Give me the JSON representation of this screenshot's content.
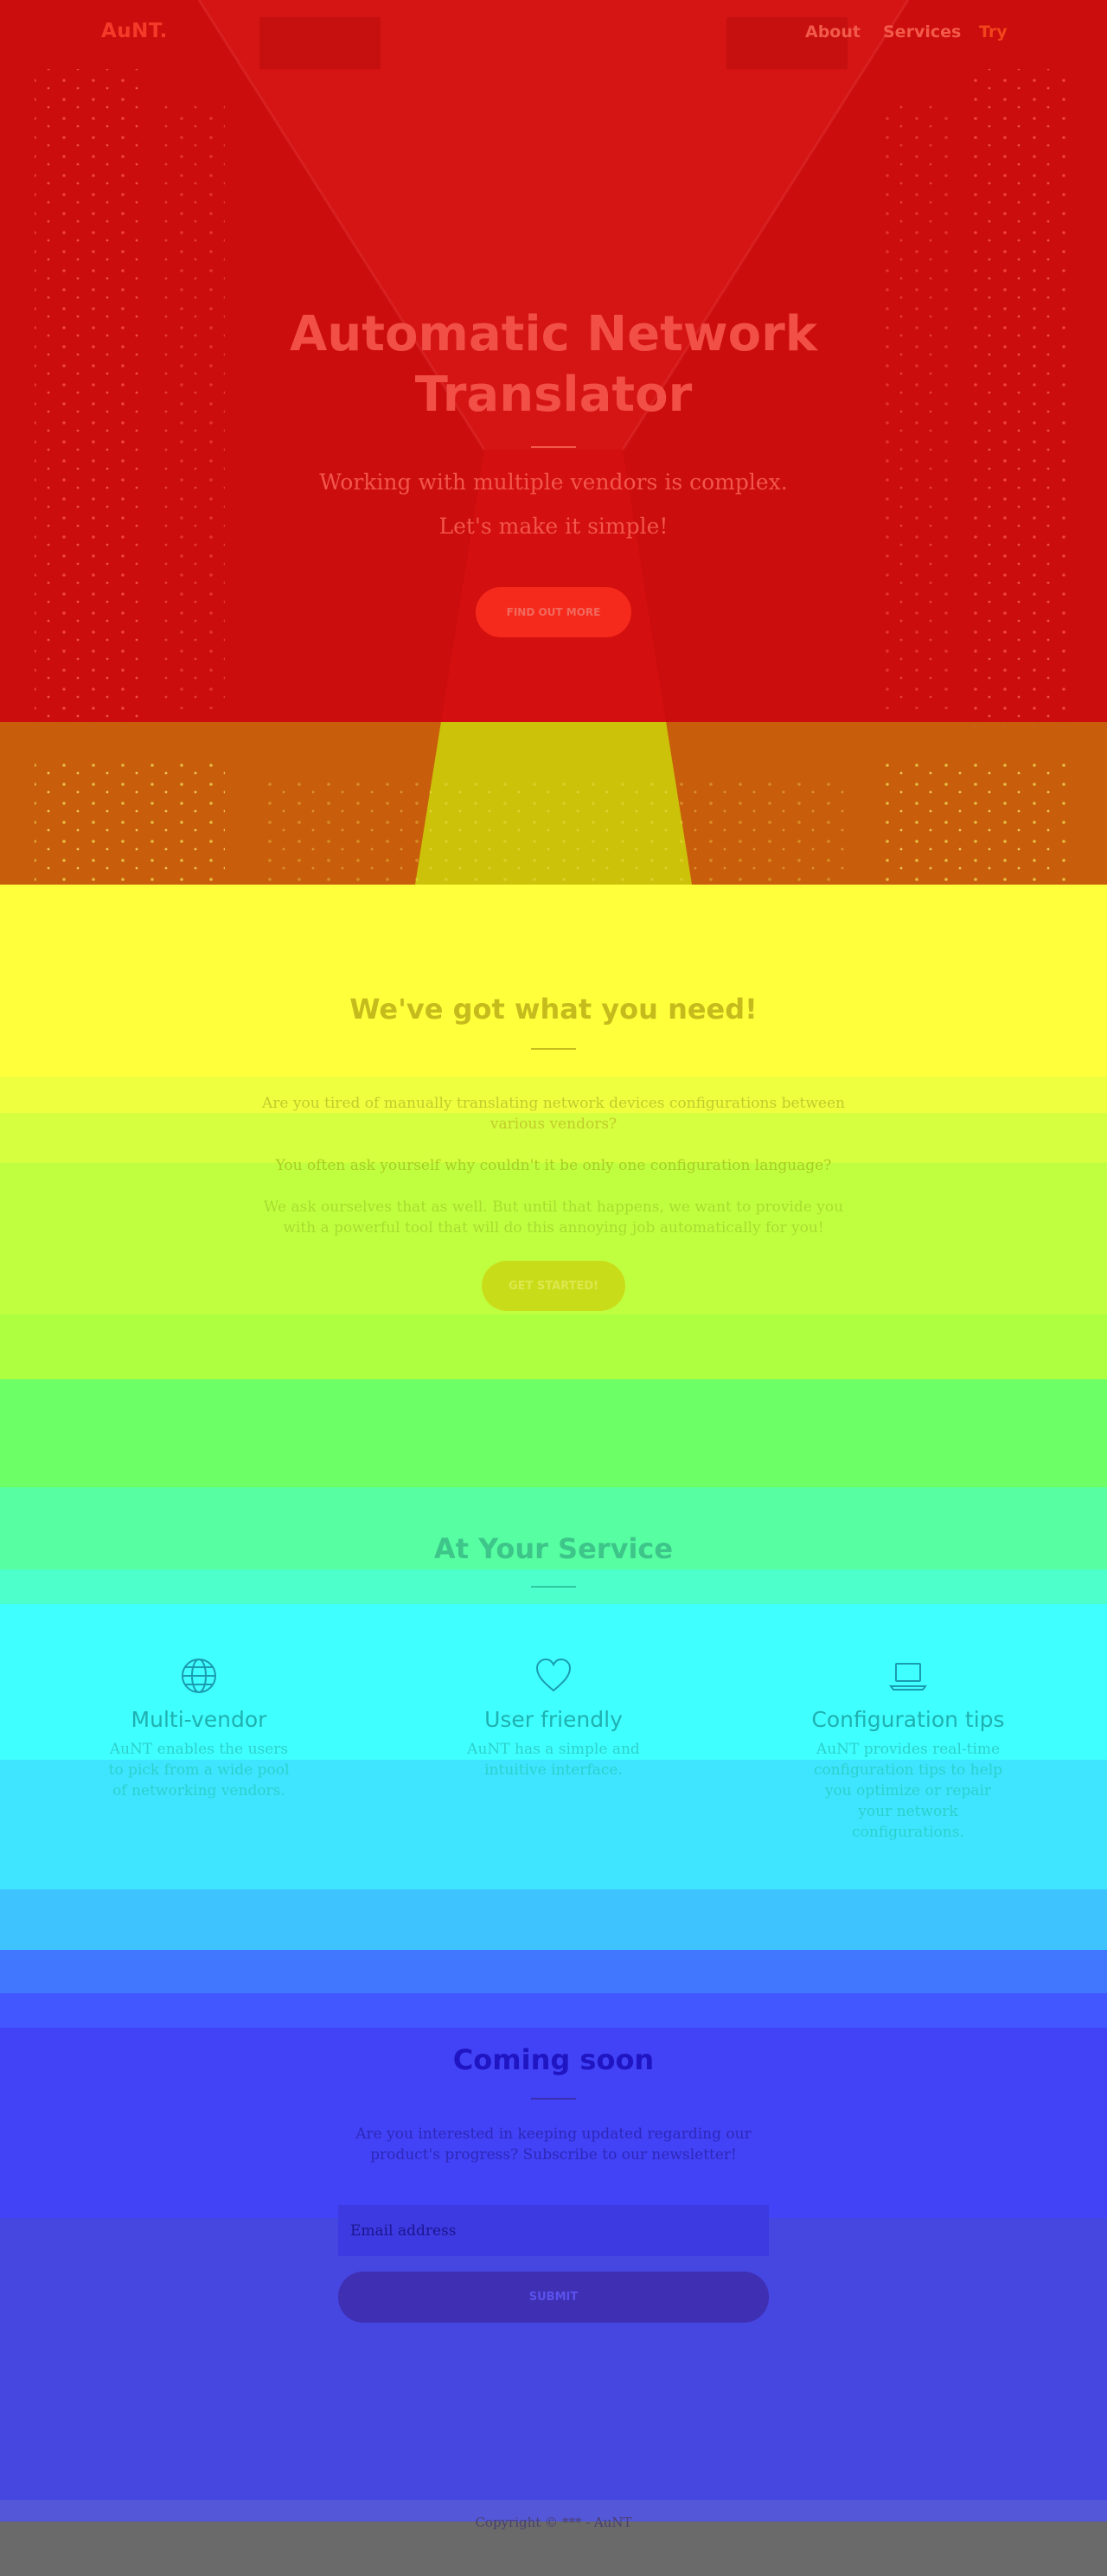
{
  "nav": {
    "brand": "AuNT.",
    "links": [
      "About",
      "Services",
      "Try"
    ]
  },
  "hero": {
    "title_line1": "Automatic Network",
    "title_line2": "Translator",
    "subtitle_line1": "Working with multiple vendors is complex.",
    "subtitle_line2": "Let's make it simple!",
    "button_label": "FIND OUT MORE"
  },
  "intro": {
    "title": "We've got what you need!",
    "para1": "Are you tired of manually translating network devices configurations between various vendors?",
    "para2": "You often ask yourself why couldn't it be only one configuration language?",
    "para3": "We ask ourselves that as well. But until that happens, we want to provide you with a powerful tool that will do this annoying job automatically for you!",
    "button_label": "GET STARTED!"
  },
  "services": {
    "title": "At Your Service",
    "items": [
      {
        "icon": "globe-icon",
        "title": "Multi-vendor",
        "desc": "AuNT enables the users to pick from a wide pool of networking vendors."
      },
      {
        "icon": "heart-icon",
        "title": "User friendly",
        "desc": "AuNT has a simple and intuitive interface."
      },
      {
        "icon": "laptop-icon",
        "title": "Configuration tips",
        "desc": "AuNT provides real-time configuration tips to help you optimize or repair your network configurations."
      }
    ]
  },
  "newsletter": {
    "title": "Coming soon",
    "text": "Are you interested in keeping updated regarding our product's progress? Subscribe to our newsletter!",
    "email_placeholder": "Email address",
    "submit_label": "SUBMIT"
  },
  "footer": {
    "copyright": "Copyright © *** - AuNT"
  },
  "colors": {
    "hero": "#d10e0e",
    "accent": "#f62a1c",
    "intro_button": "#c9dc1a",
    "service_text": "#1fb0b0",
    "newsletter_title": "#1f15c2",
    "footer_bg": "#6a6a6a"
  }
}
